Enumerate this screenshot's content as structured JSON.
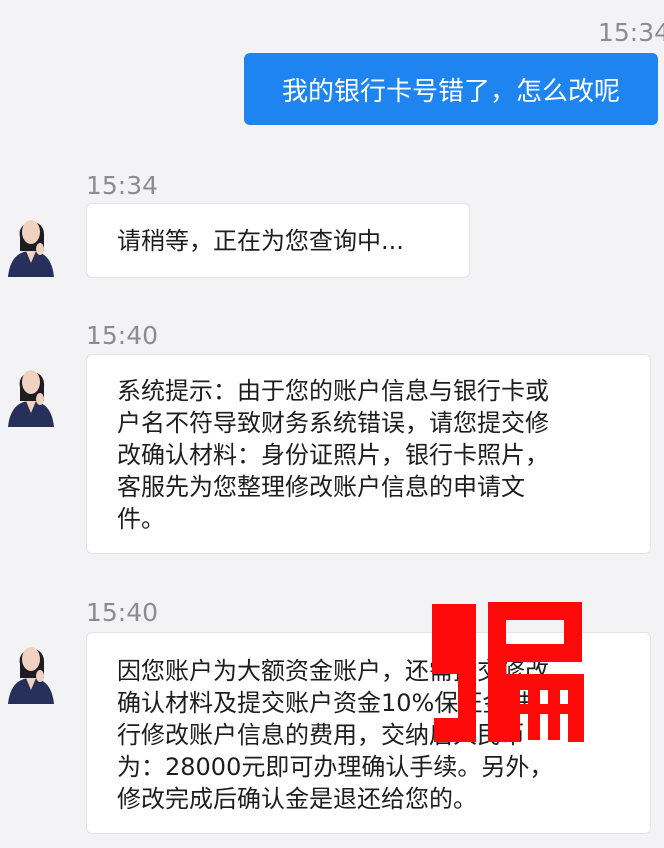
{
  "messages": [
    {
      "time": "15:34",
      "sender": "me",
      "text": "我的银行卡号错了，怎么改呢"
    },
    {
      "time": "15:34",
      "sender": "agent",
      "text": "请稍等，正在为您查询中..."
    },
    {
      "time": "15:40",
      "sender": "agent",
      "lines": [
        "系统提示：由于您的账户信息与银行卡或",
        "户名不符导致财务系统错误，请您提交修",
        "改确认材料：身份证照片，银行卡照片，",
        "客服先为您整理修改账户信息的申请文",
        "件。"
      ]
    },
    {
      "time": "15:40",
      "sender": "agent",
      "lines": [
        "因您账户为大额资金账户，还需提交修改",
        "确认材料及提交账户资金10%保证金进",
        "行修改账户信息的费用，交纳后人民币",
        "为：28000元即可办理确认手续。另外，",
        "修改完成后确认金是退还给您的。"
      ]
    }
  ],
  "overlay": {
    "stamp_text": "骗"
  },
  "colors": {
    "me_bubble": "#1e84f0",
    "stamp": "#ff0a0a",
    "background": "#f3f3f5"
  },
  "icons": {
    "avatar": "woman-avatar-icon"
  }
}
